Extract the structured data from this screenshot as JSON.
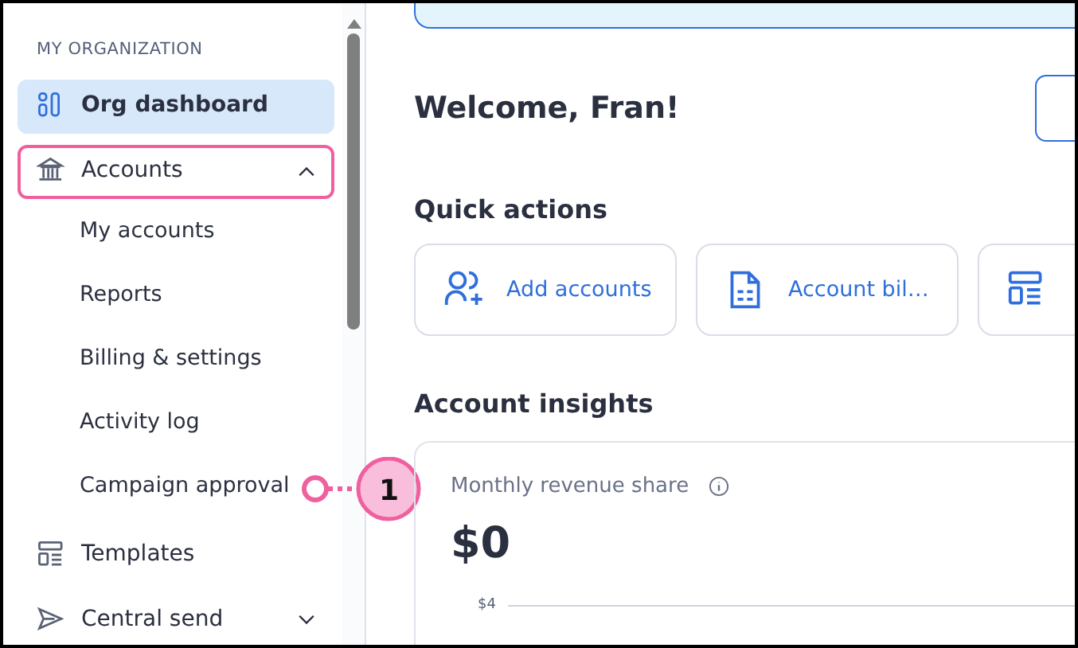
{
  "sidebar": {
    "section_title": "MY ORGANIZATION",
    "items": [
      {
        "kind": "item",
        "label": "Org dashboard",
        "selected": true,
        "highlighted": false
      },
      {
        "kind": "item",
        "label": "Accounts",
        "selected": false,
        "highlighted": true,
        "expanded": true,
        "children": [
          {
            "label": "My accounts"
          },
          {
            "label": "Reports"
          },
          {
            "label": "Billing & settings"
          },
          {
            "label": "Activity log"
          },
          {
            "label": "Campaign approval",
            "callout": "1"
          }
        ]
      },
      {
        "kind": "item",
        "label": "Templates",
        "selected": false,
        "highlighted": false
      },
      {
        "kind": "item",
        "label": "Central send",
        "selected": false,
        "highlighted": false,
        "expanded": false
      }
    ]
  },
  "main": {
    "welcome": "Welcome, Fran!",
    "quick_actions": {
      "title": "Quick actions",
      "items": [
        {
          "kind": "action",
          "label": "Add accounts"
        },
        {
          "kind": "action",
          "label": "Account bil…"
        },
        {
          "kind": "action"
        }
      ]
    },
    "insights": {
      "title": "Account insights",
      "card": {
        "title": "Monthly revenue share",
        "value": "$0",
        "y_tick": "$4"
      }
    }
  }
}
